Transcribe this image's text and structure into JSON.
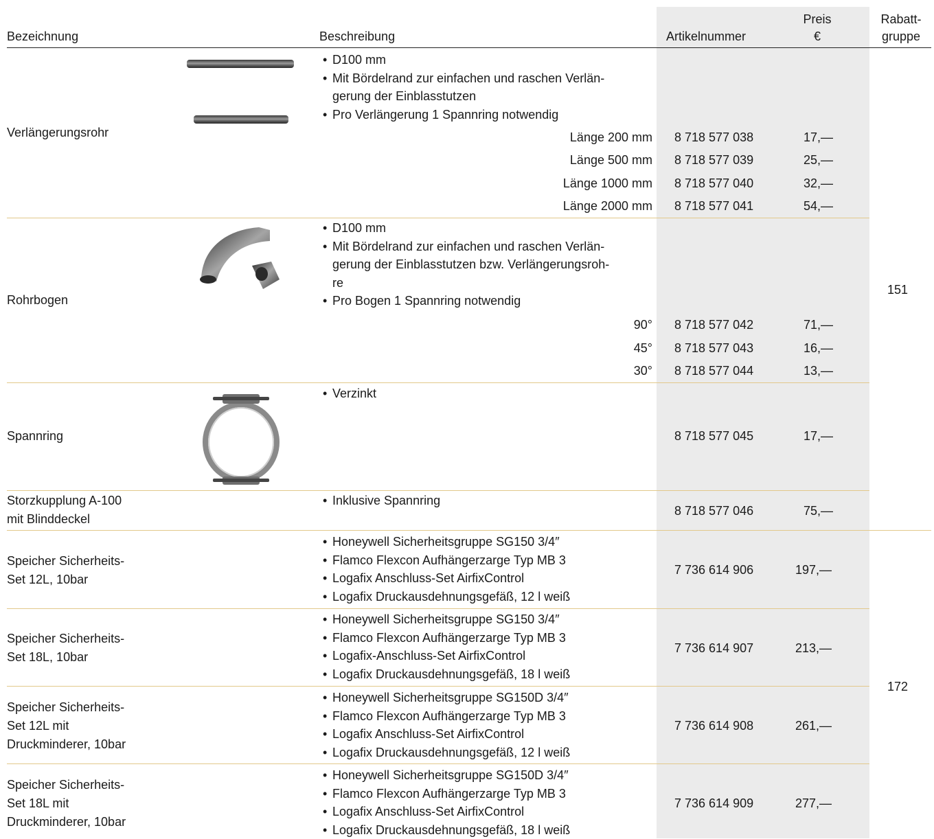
{
  "header": {
    "bezeichnung": "Bezeichnung",
    "beschreibung": "Beschreibung",
    "artikelnummer": "Artikelnummer",
    "preis_line1": "Preis",
    "preis_line2": "€",
    "rabatt_line1": "Rabatt-",
    "rabatt_line2": "gruppe"
  },
  "products": {
    "verlaengerungsrohr": {
      "name": "Verlängerungsrohr",
      "bullets": [
        "D100 mm",
        "Mit Bördelrand zur einfachen und raschen Verlän-",
        "gerung der Einblasstutzen",
        "Pro Verlängerung 1 Spannring notwendig"
      ],
      "variants": [
        {
          "label": "Länge 200 mm",
          "article": "8 718 577 038",
          "price": "17,—"
        },
        {
          "label": "Länge 500 mm",
          "article": "8 718 577 039",
          "price": "25,—"
        },
        {
          "label": "Länge 1000 mm",
          "article": "8 718 577 040",
          "price": "32,—"
        },
        {
          "label": "Länge 2000 mm",
          "article": "8 718 577 041",
          "price": "54,—"
        }
      ]
    },
    "rohrbogen": {
      "name": "Rohrbogen",
      "bullets": [
        "D100 mm",
        "Mit Bördelrand zur einfachen und raschen Verlän-",
        "gerung der Einblasstutzen bzw. Verlängerungsroh-",
        "re",
        "Pro Bogen 1 Spannring notwendig"
      ],
      "variants": [
        {
          "label": "90°",
          "article": "8 718 577 042",
          "price": "71,—"
        },
        {
          "label": "45°",
          "article": "8 718 577 043",
          "price": "16,—"
        },
        {
          "label": "30°",
          "article": "8 718 577 044",
          "price": "13,—"
        }
      ]
    },
    "spannring": {
      "name": "Spannring",
      "bullets": [
        "Verzinkt"
      ],
      "article": "8 718 577 045",
      "price": "17,—"
    },
    "storzkupplung": {
      "name_line1": "Storzkupplung A-100",
      "name_line2": "mit Blinddeckel",
      "bullets": [
        "Inklusive Spannring"
      ],
      "article": "8 718 577 046",
      "price": "75,—"
    },
    "set1": {
      "name_line1": "Speicher Sicherheits-",
      "name_line2": "Set 12L, 10bar",
      "bullets": [
        "Honeywell Sicherheitsgruppe SG150 3/4″",
        "Flamco Flexcon Aufhängerzarge Typ MB 3",
        "Logafix Anschluss-Set AirfixControl",
        "Logafix Druckausdehnungsgefäß, 12 l weiß"
      ],
      "article": "7 736 614 906",
      "price": "197,—"
    },
    "set2": {
      "name_line1": "Speicher Sicherheits-",
      "name_line2": "Set 18L, 10bar",
      "bullets": [
        "Honeywell Sicherheitsgruppe SG150 3/4″",
        "Flamco Flexcon Aufhängerzarge Typ MB 3",
        "Logafix-Anschluss-Set AirfixControl",
        "Logafix Druckausdehnungsgefäß, 18 l weiß"
      ],
      "article": "7 736 614 907",
      "price": "213,—"
    },
    "set3": {
      "name_line1": "Speicher Sicherheits-",
      "name_line2": "Set 12L mit",
      "name_line3": "Druckminderer, 10bar",
      "bullets": [
        "Honeywell Sicherheitsgruppe SG150D 3/4″",
        "Flamco Flexcon Aufhängerzarge Typ MB 3",
        "Logafix Anschluss-Set AirfixControl",
        "Logafix Druckausdehnungsgefäß, 12 l weiß"
      ],
      "article": "7 736 614 908",
      "price": "261,—"
    },
    "set4": {
      "name_line1": "Speicher Sicherheits-",
      "name_line2": "Set 18L mit",
      "name_line3": "Druckminderer, 10bar",
      "bullets": [
        "Honeywell Sicherheitsgruppe SG150D 3/4″",
        "Flamco Flexcon Aufhängerzarge Typ MB 3",
        "Logafix Anschluss-Set AirfixControl",
        "Logafix Druckausdehnungsgefäß, 18 l weiß"
      ],
      "article": "7 736 614 909",
      "price": "277,—"
    }
  },
  "rabatt_groups": {
    "group_a": "151",
    "group_b": "172"
  },
  "colors": {
    "shade": "#ebebeb",
    "separator": "#e2c88a",
    "header_rule": "#222222"
  }
}
